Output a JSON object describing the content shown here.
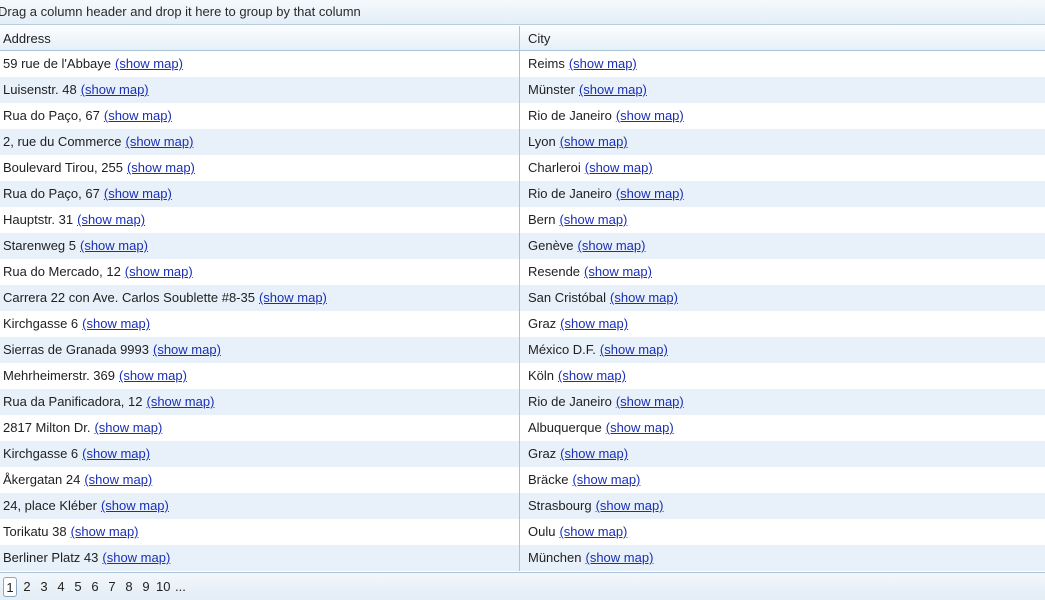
{
  "group_panel": {
    "text": "Drag a column header and drop it here to group by that column"
  },
  "columns": {
    "address": "Address",
    "city": "City"
  },
  "map_link_label": "(show map)",
  "rows": [
    {
      "address": "59 rue de l'Abbaye",
      "city": "Reims"
    },
    {
      "address": "Luisenstr. 48",
      "city": "Münster"
    },
    {
      "address": "Rua do Paço, 67",
      "city": "Rio de Janeiro"
    },
    {
      "address": "2, rue du Commerce",
      "city": "Lyon"
    },
    {
      "address": "Boulevard Tirou, 255",
      "city": "Charleroi"
    },
    {
      "address": "Rua do Paço, 67",
      "city": "Rio de Janeiro"
    },
    {
      "address": "Hauptstr. 31",
      "city": "Bern"
    },
    {
      "address": "Starenweg 5",
      "city": "Genève"
    },
    {
      "address": "Rua do Mercado, 12",
      "city": "Resende"
    },
    {
      "address": "Carrera 22 con Ave. Carlos Soublette #8-35",
      "city": "San Cristóbal"
    },
    {
      "address": "Kirchgasse 6",
      "city": "Graz"
    },
    {
      "address": "Sierras de Granada 9993",
      "city": "México D.F."
    },
    {
      "address": "Mehrheimerstr. 369",
      "city": "Köln"
    },
    {
      "address": "Rua da Panificadora, 12",
      "city": "Rio de Janeiro"
    },
    {
      "address": "2817 Milton Dr.",
      "city": "Albuquerque"
    },
    {
      "address": "Kirchgasse 6",
      "city": "Graz"
    },
    {
      "address": "Åkergatan 24",
      "city": "Bräcke"
    },
    {
      "address": "24, place Kléber",
      "city": "Strasbourg"
    },
    {
      "address": "Torikatu 38",
      "city": "Oulu"
    },
    {
      "address": "Berliner Platz 43",
      "city": "München"
    }
  ],
  "pager": {
    "pages": [
      "1",
      "2",
      "3",
      "4",
      "5",
      "6",
      "7",
      "8",
      "9",
      "10",
      "..."
    ],
    "current": "1"
  }
}
